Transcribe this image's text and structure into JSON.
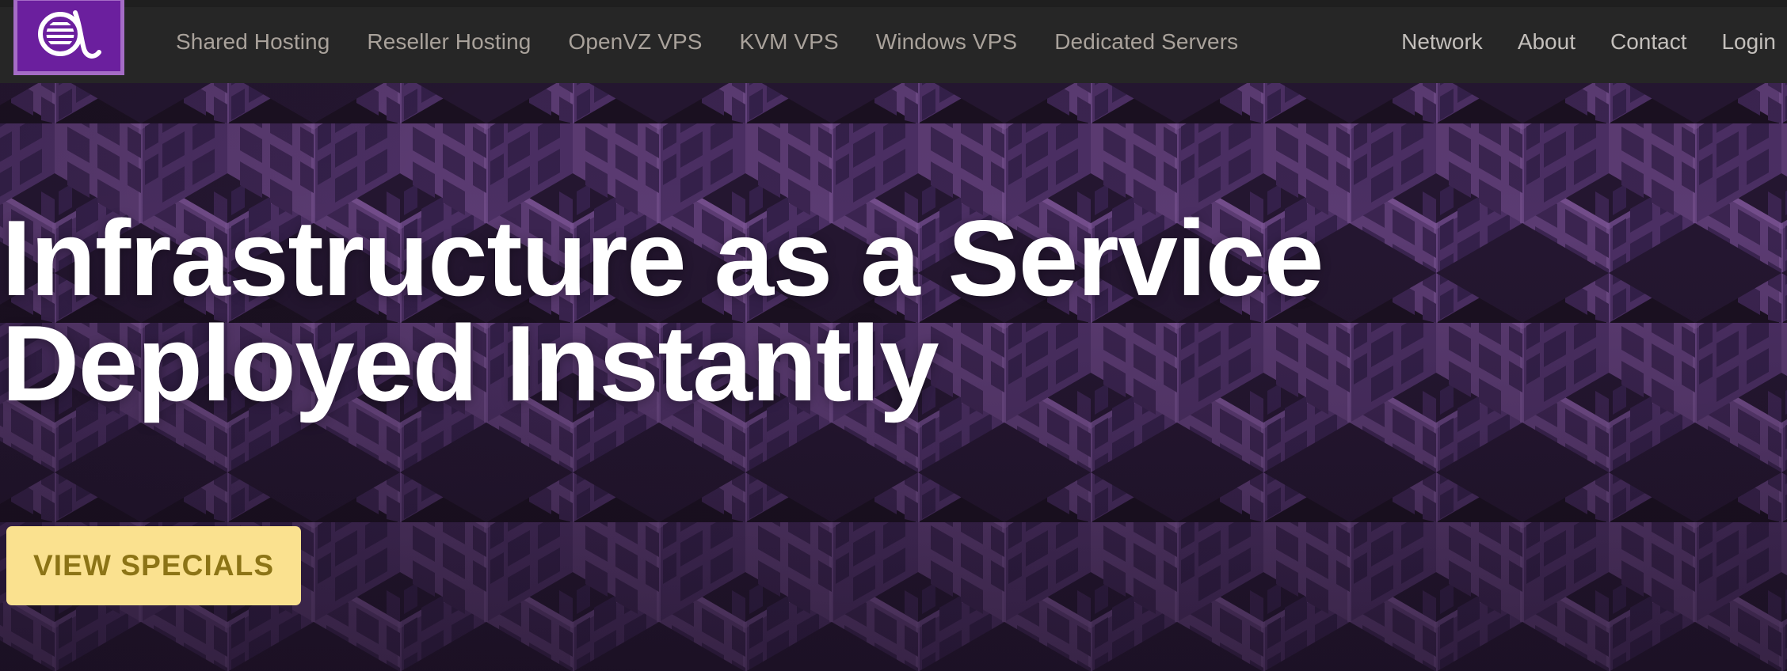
{
  "site": {
    "logo": {
      "icon": "alpha-logo-icon",
      "square_color": "#6b1f9e",
      "border_color": "#a56cc6",
      "glyph_color": "#ffffff"
    }
  },
  "header": {
    "background_color": "#262626",
    "primary_nav": [
      {
        "label": "Shared Hosting"
      },
      {
        "label": "Reseller Hosting"
      },
      {
        "label": "OpenVZ VPS"
      },
      {
        "label": "KVM VPS"
      },
      {
        "label": "Windows VPS"
      },
      {
        "label": "Dedicated Servers"
      }
    ],
    "secondary_nav": [
      {
        "label": "Network"
      },
      {
        "label": "About"
      },
      {
        "label": "Contact"
      },
      {
        "label": "Login"
      }
    ],
    "primary_link_color": "#a9a29b",
    "secondary_link_color": "#c3bfbb"
  },
  "hero": {
    "headline_line1": "Infrastructure as a Service",
    "headline_line2": "Deployed Instantly",
    "headline_color": "#ffffff",
    "cta": {
      "label": "VIEW SPECIALS",
      "background_color": "#fae18f",
      "text_color": "#8c7416"
    },
    "background": {
      "style": "isometric-cube-pattern",
      "base_color": "#1a1020",
      "cube_top_color": "#241630",
      "cube_left_face_color": "#5b3b72",
      "cube_right_face_color": "#4b2f63",
      "window_color": "#3b2450",
      "edge_highlight_color": "#7a5393"
    }
  }
}
